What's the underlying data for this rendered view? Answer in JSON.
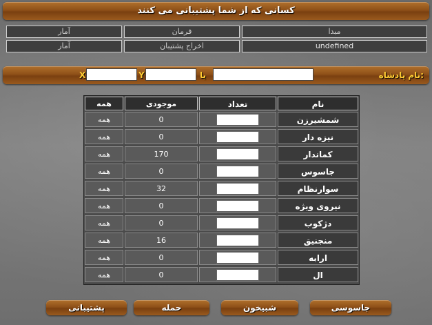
{
  "title": "کسانی که از شما پشتیبانی می کنند",
  "top_grid": {
    "row1": [
      "آمار",
      "فرمان",
      "مبدا"
    ],
    "row2": [
      "آمار",
      "اخراج پشتیبان",
      "undefined"
    ]
  },
  "king_bar": {
    "label": "نام پادشاه:",
    "or": "یا",
    "y": "Y",
    "x": "X"
  },
  "table": {
    "headers": {
      "all": "همه",
      "available": "موجودی",
      "count": "تعداد",
      "name": "نام"
    },
    "rows": [
      {
        "name": "شمشیرزن",
        "available": "0",
        "all": "همه"
      },
      {
        "name": "نیزه دار",
        "available": "0",
        "all": "همه"
      },
      {
        "name": "کماندار",
        "available": "170",
        "all": "همه"
      },
      {
        "name": "جاسوس",
        "available": "0",
        "all": "همه"
      },
      {
        "name": "سوارنظام",
        "available": "32",
        "all": "همه"
      },
      {
        "name": "نیروی ویژه",
        "available": "0",
        "all": "همه"
      },
      {
        "name": "دژکوب",
        "available": "0",
        "all": "همه"
      },
      {
        "name": "منجنیق",
        "available": "16",
        "all": "همه"
      },
      {
        "name": "ارابه",
        "available": "0",
        "all": "همه"
      },
      {
        "name": "ال",
        "available": "0",
        "all": "همه"
      }
    ]
  },
  "buttons": {
    "support": "پشتیبانی",
    "attack": "حمله",
    "raid": "شبیخون",
    "spy": "جاسوسی"
  },
  "colors": {
    "wood": "#8e5018",
    "label_gold": "#ffcc33"
  }
}
